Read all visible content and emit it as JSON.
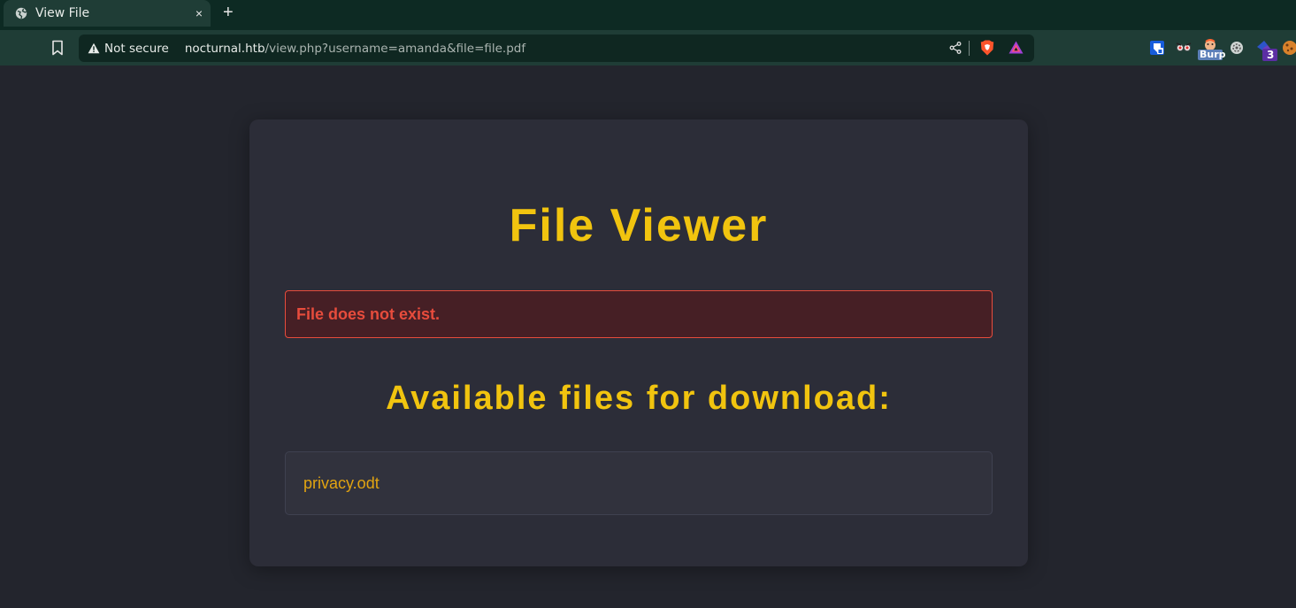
{
  "browser": {
    "tab": {
      "title": "View File",
      "close_label": "×",
      "icon": "globe-icon"
    },
    "new_tab_label": "+",
    "address_bar": {
      "security_label": "Not secure",
      "url_host": "nocturnal.htb",
      "url_path": "/view.php?username=amanda&file=file.pdf"
    },
    "extensions": [
      {
        "name": "bitwarden-icon",
        "badge": ""
      },
      {
        "name": "wappalyzer-icon",
        "badge": ""
      },
      {
        "name": "burp-icon",
        "badge": "Burp"
      },
      {
        "name": "extension-gear-icon",
        "badge": ""
      },
      {
        "name": "hackbar-icon",
        "badge": "3"
      },
      {
        "name": "cookie-icon",
        "badge": ""
      }
    ]
  },
  "page": {
    "heading": "File Viewer",
    "error_message": "File does not exist.",
    "subheading": "Available files for download:",
    "files": [
      {
        "name": "privacy.odt"
      }
    ]
  },
  "colors": {
    "accent": "#f1c40f",
    "error": "#e74c3c",
    "link": "#e2a411"
  }
}
